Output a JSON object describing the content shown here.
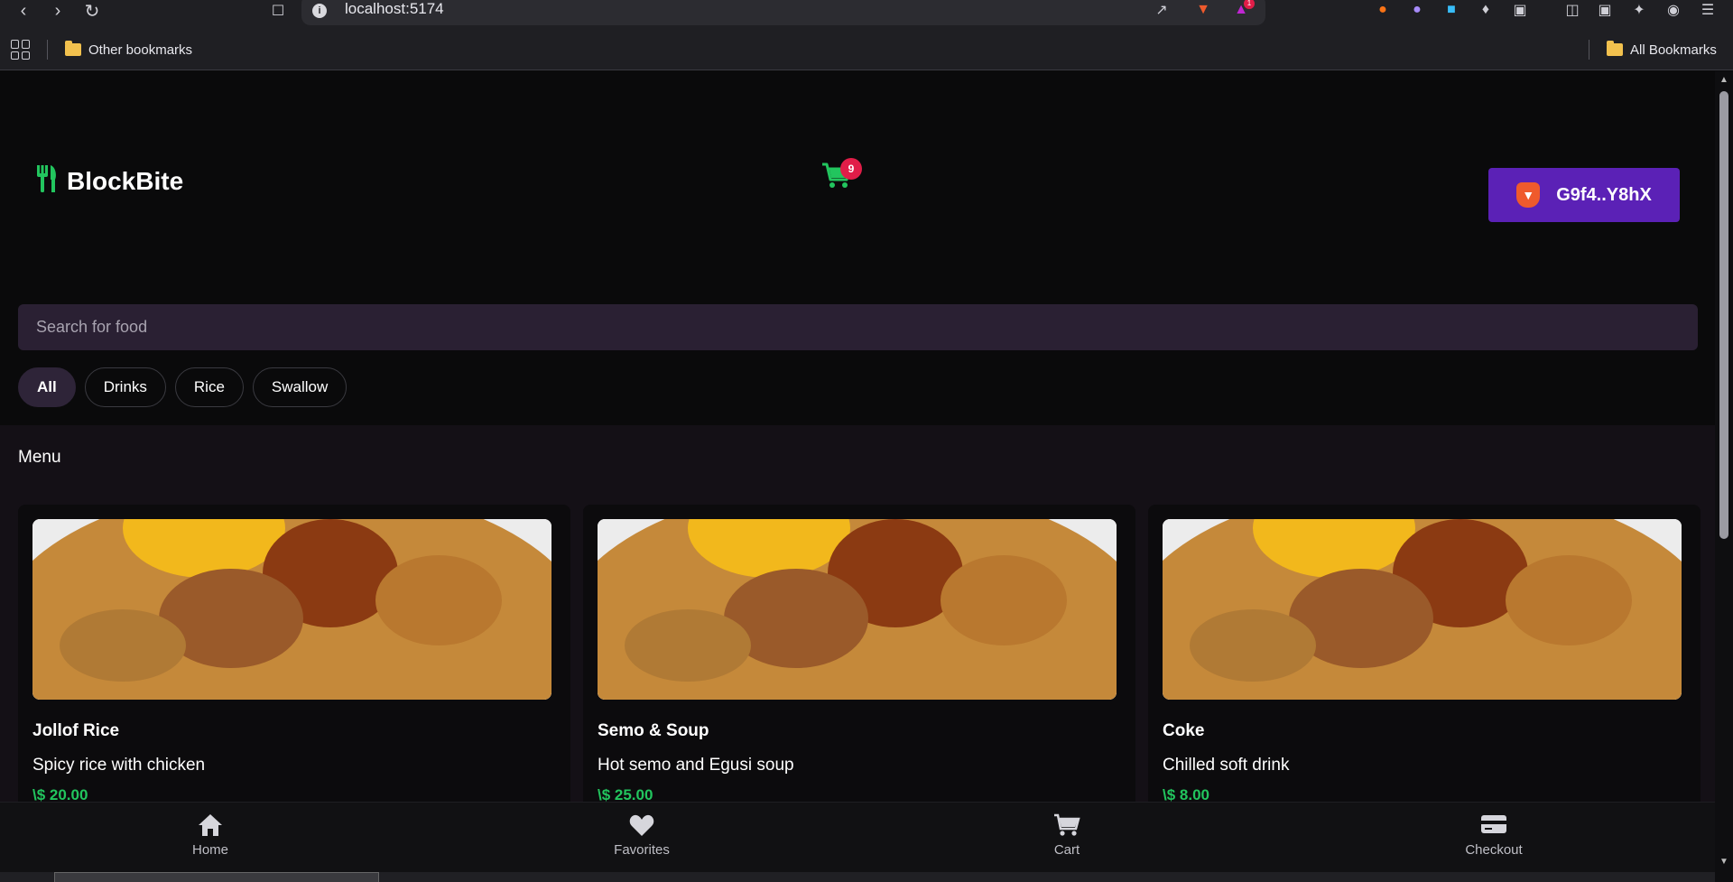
{
  "browser": {
    "url": "localhost:5174",
    "bookmarks": {
      "other": "Other bookmarks",
      "all": "All Bookmarks"
    },
    "extension_badge": "1"
  },
  "app": {
    "brand": "BlockBite",
    "cart_count": "9",
    "wallet_label": "G9f4..Y8hX",
    "accent_color": "#22c55e",
    "wallet_color": "#5b21b6"
  },
  "search": {
    "placeholder": "Search for food"
  },
  "filters": [
    "All",
    "Drinks",
    "Rice",
    "Swallow"
  ],
  "menu": {
    "title": "Menu",
    "items": [
      {
        "name": "Jollof Rice",
        "description": "Spicy rice with chicken",
        "price": "\\$ 20.00"
      },
      {
        "name": "Semo & Soup",
        "description": "Hot semo and Egusi soup",
        "price": "\\$ 25.00"
      },
      {
        "name": "Coke",
        "description": "Chilled soft drink",
        "price": "\\$ 8.00"
      }
    ]
  },
  "bottom_nav": [
    {
      "label": "Home",
      "icon": "home-icon"
    },
    {
      "label": "Favorites",
      "icon": "heart-icon"
    },
    {
      "label": "Cart",
      "icon": "cart-icon"
    },
    {
      "label": "Checkout",
      "icon": "credit-card-icon"
    }
  ]
}
